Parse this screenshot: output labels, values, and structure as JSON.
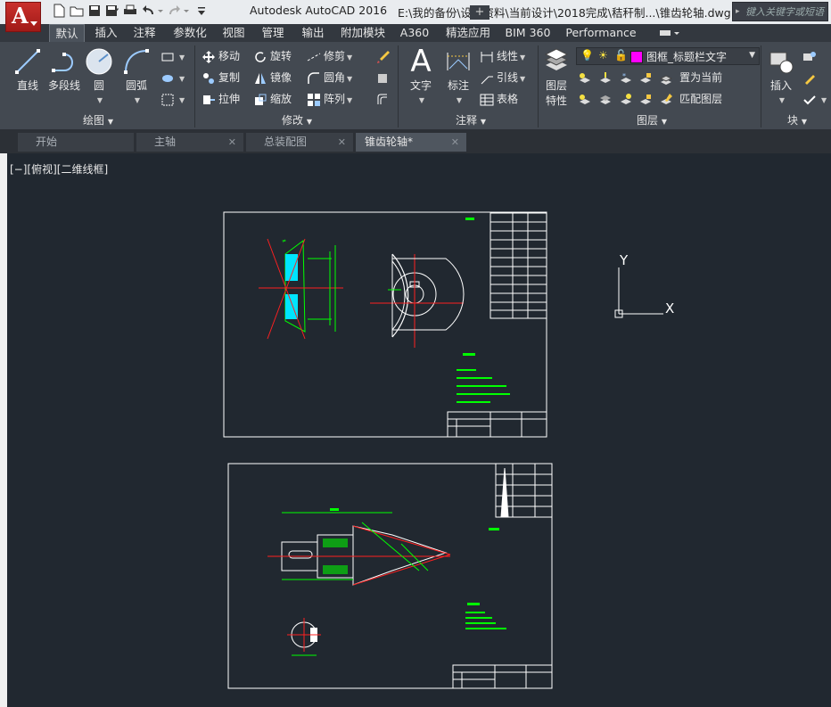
{
  "titlebar": {
    "app_title": "Autodesk AutoCAD 2016",
    "file_title": "E:\\我的备份\\设计资料\\当前设计\\2018完成\\秸秆制...\\锥齿轮轴.dwg",
    "search_placeholder": "键入关键字或短语"
  },
  "quick_access": [
    "new-icon",
    "open-icon",
    "save-icon",
    "saveas-icon",
    "plot-icon",
    "undo-icon",
    "redo-icon",
    "customize-icon"
  ],
  "ribbon_tabs": [
    "默认",
    "插入",
    "注释",
    "参数化",
    "视图",
    "管理",
    "输出",
    "附加模块",
    "A360",
    "精选应用",
    "BIM 360",
    "Performance"
  ],
  "ribbon": {
    "draw": {
      "title": "绘图",
      "line": "直线",
      "polyline": "多段线",
      "circle": "圆",
      "arc": "圆弧"
    },
    "modify": {
      "title": "修改",
      "move": "移动",
      "rotate": "旋转",
      "trim": "修剪",
      "copy": "复制",
      "mirror": "镜像",
      "fillet": "圆角",
      "stretch": "拉伸",
      "scale": "缩放",
      "array": "阵列"
    },
    "annotation": {
      "title": "注释",
      "text": "文字",
      "dimension": "标注",
      "linear": "线性",
      "leader": "引线",
      "table": "表格"
    },
    "layers": {
      "title": "图层",
      "properties": "图层\n特性",
      "properties_l1": "图层",
      "properties_l2": "特性",
      "current_layer": "图框_标题栏文字",
      "layer_color": "#ff00ff",
      "set_current": "置为当前",
      "match_layer": "匹配图层"
    },
    "block": {
      "title": "块",
      "insert": "插入"
    }
  },
  "doc_tabs": [
    {
      "label": "开始",
      "active": false
    },
    {
      "label": "主轴",
      "active": false
    },
    {
      "label": "总装配图",
      "active": false
    },
    {
      "label": "锥齿轮轴*",
      "active": true
    }
  ],
  "viewport": {
    "label": "[−][俯视][二维线框]",
    "ucs_x": "X",
    "ucs_y": "Y"
  }
}
